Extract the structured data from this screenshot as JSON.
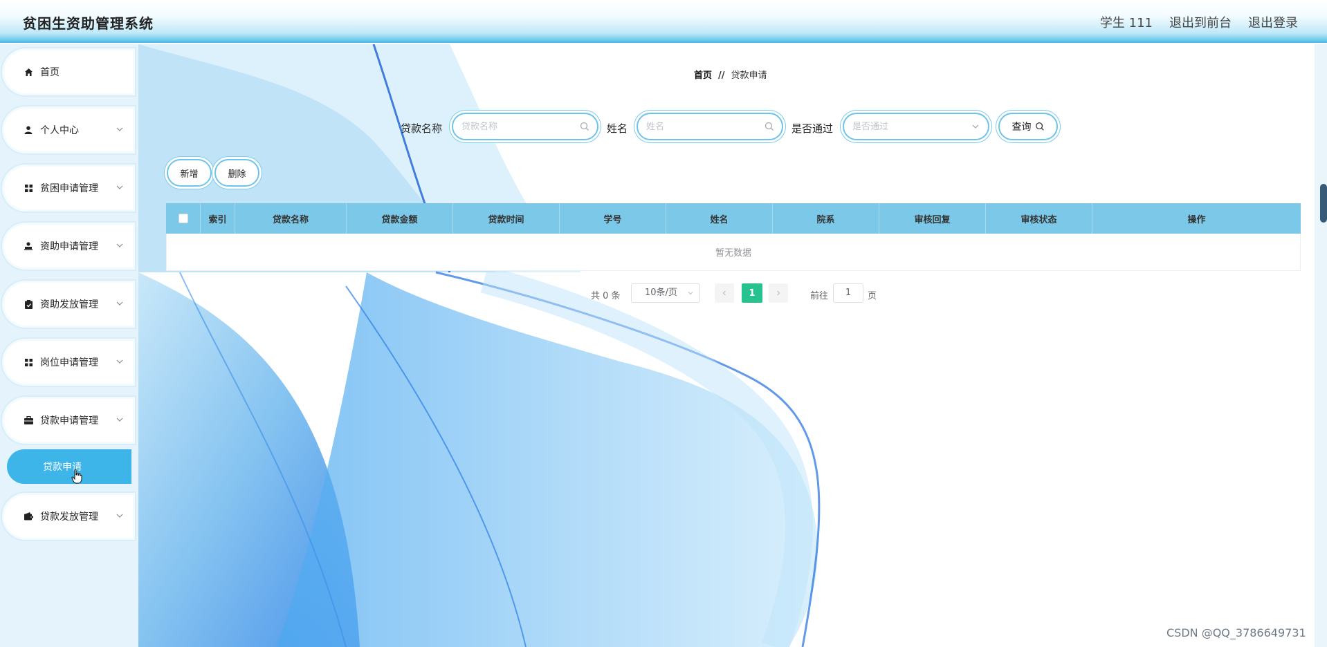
{
  "header": {
    "title": "贫困生资助管理系统",
    "user_label": "学生 111",
    "back_to_front": "退出到前台",
    "logout": "退出登录"
  },
  "sidebar": {
    "items": [
      {
        "label": "首页",
        "icon": "home-icon",
        "has_submenu": false
      },
      {
        "label": "个人中心",
        "icon": "user-icon",
        "has_submenu": true
      },
      {
        "label": "贫困申请管理",
        "icon": "grid-icon",
        "has_submenu": true
      },
      {
        "label": "资助申请管理",
        "icon": "user-stamp-icon",
        "has_submenu": true
      },
      {
        "label": "资助发放管理",
        "icon": "clipboard-icon",
        "has_submenu": true
      },
      {
        "label": "岗位申请管理",
        "icon": "grid-icon",
        "has_submenu": true
      },
      {
        "label": "贷款申请管理",
        "icon": "briefcase-icon",
        "has_submenu": true
      },
      {
        "label": "贷款发放管理",
        "icon": "wallet-icon",
        "has_submenu": true
      }
    ],
    "active_submenu": "贷款申请"
  },
  "breadcrumb": {
    "home": "首页",
    "separator": "//",
    "current": "贷款申请"
  },
  "search": {
    "loan_name_label": "贷款名称",
    "loan_name_placeholder": "贷款名称",
    "name_label": "姓名",
    "name_placeholder": "姓名",
    "passed_label": "是否通过",
    "passed_placeholder": "是否通过",
    "query_button": "查询"
  },
  "actions": {
    "add": "新增",
    "delete": "删除"
  },
  "table": {
    "columns": [
      "索引",
      "贷款名称",
      "贷款金额",
      "贷款时间",
      "学号",
      "姓名",
      "院系",
      "审核回复",
      "审核状态",
      "操作"
    ],
    "rows": [],
    "empty_text": "暂无数据"
  },
  "pagination": {
    "total_text": "共 0 条",
    "page_size": "10条/页",
    "current_page": "1",
    "goto_label": "前往",
    "goto_value": "1",
    "page_unit": "页"
  },
  "watermark": "CSDN @QQ_3786649731",
  "colors": {
    "accent": "#3eb5e8",
    "table_header": "#7cc8e8",
    "page_active": "#27c28f"
  }
}
